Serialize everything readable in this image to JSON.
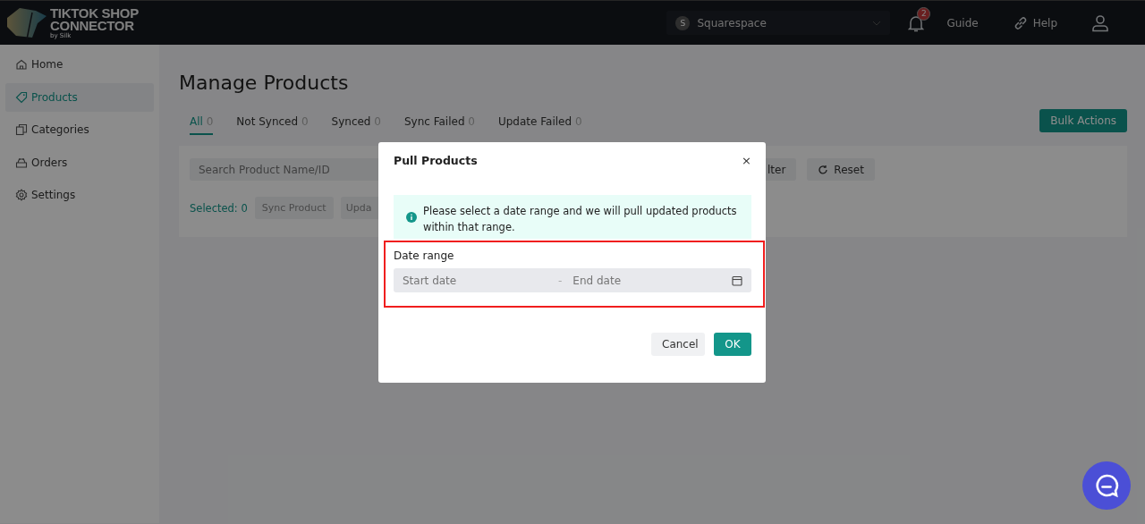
{
  "header": {
    "logo": {
      "line_1": "TIKTOK SHOP",
      "line_2": "CONNECTOR",
      "byline": "by Silk"
    },
    "store_select": {
      "avatar": "S",
      "value": "Squarespace"
    },
    "notifications": {
      "count": "2"
    },
    "links": [
      {
        "label": "Guide",
        "kind": "plain"
      },
      {
        "label": "Help",
        "kind": "link"
      }
    ]
  },
  "sidebar": {
    "items": [
      {
        "label": "Home",
        "selected": false
      },
      {
        "label": "Products",
        "selected": true
      },
      {
        "label": "Categories",
        "selected": false
      },
      {
        "label": "Orders",
        "selected": false
      },
      {
        "label": "Settings",
        "selected": false
      }
    ]
  },
  "page": {
    "title": "Manage Products",
    "bulk_button": "Bulk Actions",
    "tabs": [
      {
        "label": "All",
        "count": "0",
        "selected": true
      },
      {
        "label": "Not Synced",
        "count": "0",
        "selected": false
      },
      {
        "label": "Synced",
        "count": "0",
        "selected": false
      },
      {
        "label": "Sync Failed",
        "count": "0",
        "selected": false
      },
      {
        "label": "Update Failed",
        "count": "0",
        "selected": false
      }
    ],
    "search": {
      "placeholder": "Search Product Name/ID"
    },
    "filter_button": "lter",
    "reset_button": "Reset",
    "selected_label": "Selected: 0",
    "actions": [
      "Sync Product",
      "Upda"
    ]
  },
  "dialog": {
    "title": "Pull Products",
    "close": "×",
    "notice": "Please select a date range and we will pull updated products within that range.",
    "highlighted": true,
    "field_label": "Date range",
    "start_placeholder": "Start date",
    "separator": "-",
    "end_placeholder": "End date",
    "buttons": [
      {
        "label": "Cancel",
        "kind": "secondary"
      },
      {
        "label": "OK",
        "kind": "primary"
      }
    ]
  }
}
